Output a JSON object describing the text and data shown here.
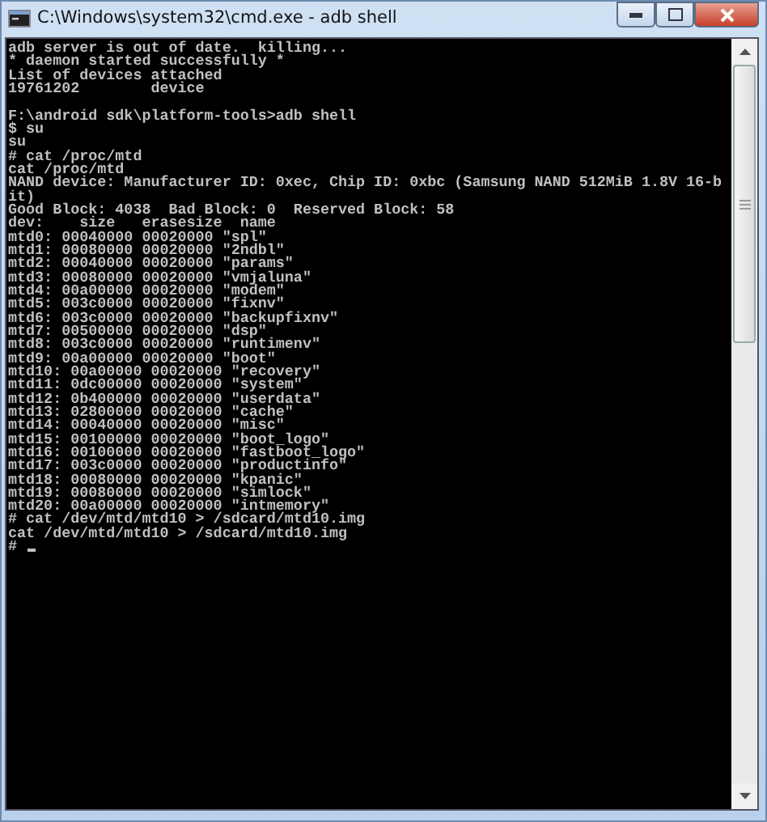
{
  "window": {
    "title": "C:\\Windows\\system32\\cmd.exe - adb  shell"
  },
  "console": {
    "blocks": [
      [
        "adb server is out of date.  killing...",
        "* daemon started successfully *",
        "List of devices attached",
        "19761202        device"
      ],
      [
        "F:\\android sdk\\platform-tools>adb shell",
        "$ su",
        "su",
        "# cat /proc/mtd",
        "cat /proc/mtd",
        "NAND device: Manufacturer ID: 0xec, Chip ID: 0xbc (Samsung NAND 512MiB 1.8V 16-b",
        "it)",
        "Good Block: 4038  Bad Block: 0  Reserved Block: 58",
        "dev:    size   erasesize  name",
        "mtd0: 00040000 00020000 \"spl\"",
        "mtd1: 00080000 00020000 \"2ndbl\"",
        "mtd2: 00040000 00020000 \"params\"",
        "mtd3: 00080000 00020000 \"vmjaluna\"",
        "mtd4: 00a00000 00020000 \"modem\"",
        "mtd5: 003c0000 00020000 \"fixnv\"",
        "mtd6: 003c0000 00020000 \"backupfixnv\"",
        "mtd7: 00500000 00020000 \"dsp\"",
        "mtd8: 003c0000 00020000 \"runtimenv\"",
        "mtd9: 00a00000 00020000 \"boot\"",
        "mtd10: 00a00000 00020000 \"recovery\"",
        "mtd11: 0dc00000 00020000 \"system\"",
        "mtd12: 0b400000 00020000 \"userdata\"",
        "mtd13: 02800000 00020000 \"cache\"",
        "mtd14: 00040000 00020000 \"misc\"",
        "mtd15: 00100000 00020000 \"boot_logo\"",
        "mtd16: 00100000 00020000 \"fastboot_logo\"",
        "mtd17: 003c0000 00020000 \"productinfo\"",
        "mtd18: 00080000 00020000 \"kpanic\"",
        "mtd19: 00080000 00020000 \"simlock\"",
        "mtd20: 00a00000 00020000 \"intmemory\"",
        "# cat /dev/mtd/mtd10 > /sdcard/mtd10.img",
        "cat /dev/mtd/mtd10 > /sdcard/mtd10.img",
        "#"
      ]
    ],
    "cursor": true
  }
}
